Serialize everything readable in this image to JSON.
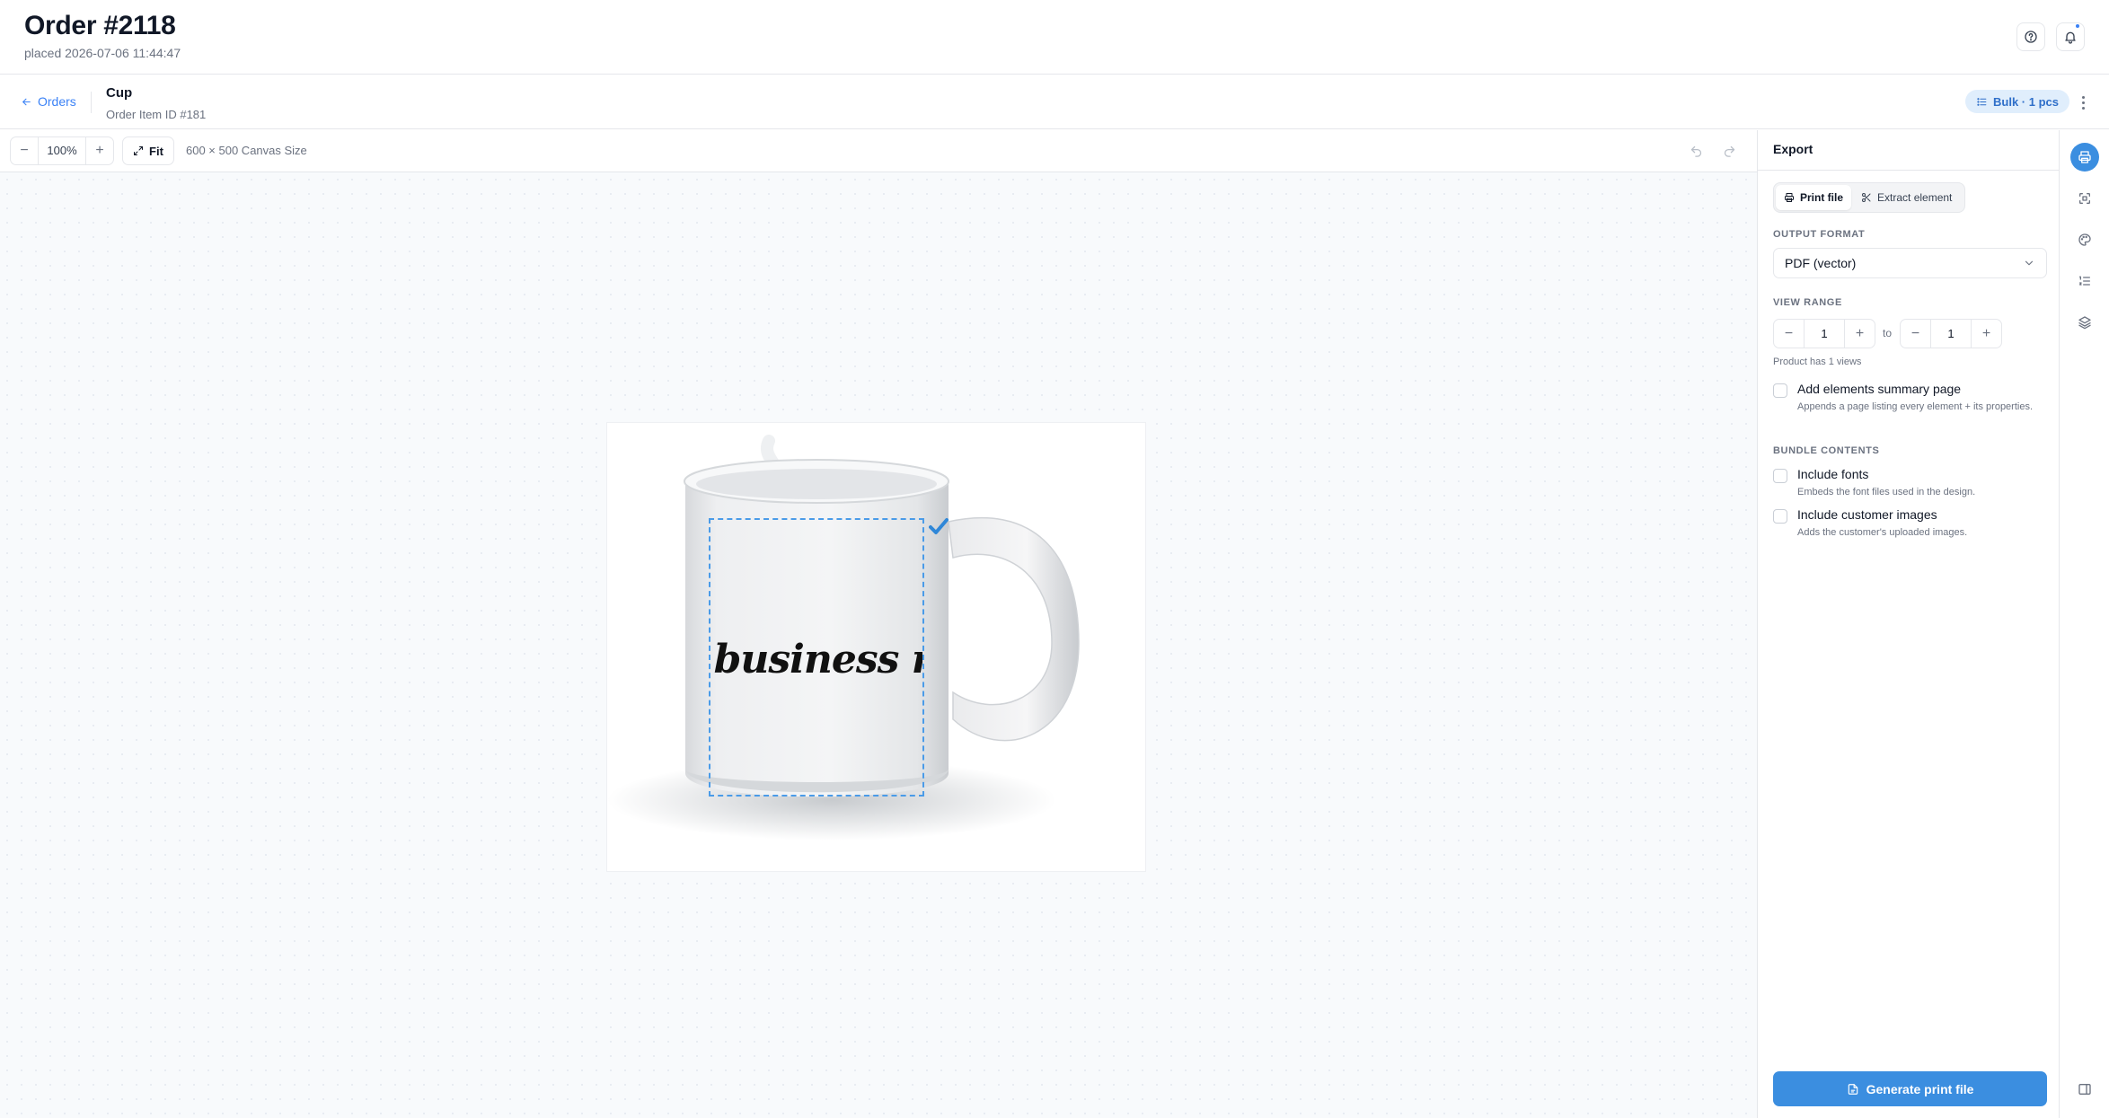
{
  "header": {
    "title": "Order #2118",
    "subtitle": "placed 2026-07-06 11:44:47",
    "help_icon": "help-circle-icon",
    "bell_icon": "bell-icon",
    "notification_dot_color": "#3b82f6"
  },
  "subheader": {
    "back_label": "Orders",
    "product_name": "Cup",
    "item_id": "Order Item ID #181",
    "bulk_badge": "Bulk · 1 pcs",
    "more_icon": "more-vertical-icon"
  },
  "toolbar": {
    "zoom_minus": "−",
    "zoom_value": "100%",
    "zoom_plus": "+",
    "fit_label": "Fit",
    "canvas_size": "600 × 500 Canvas Size",
    "undo_icon": "undo-icon",
    "redo_icon": "redo-icon"
  },
  "canvas": {
    "design_text": "Your business name",
    "print_area_color": "#4a9be8",
    "product_image": "white-ceramic-mug"
  },
  "export_panel": {
    "title": "Export",
    "tabs": [
      {
        "label": "Print file",
        "icon": "printer-icon",
        "active": true
      },
      {
        "label": "Extract element",
        "icon": "scissors-icon",
        "active": false
      }
    ],
    "output_format_label": "OUTPUT FORMAT",
    "output_format_value": "PDF (vector)",
    "view_range_label": "VIEW RANGE",
    "range_from": "1",
    "range_to_label": "to",
    "range_to": "1",
    "views_hint": "Product has 1 views",
    "summary_page": {
      "title": "Add elements summary page",
      "description": "Appends a page listing every element + its properties.",
      "checked": false
    },
    "bundle_label": "BUNDLE CONTENTS",
    "include_fonts": {
      "title": "Include fonts",
      "description": "Embeds the font files used in the design.",
      "checked": false
    },
    "include_images": {
      "title": "Include customer images",
      "description": "Adds the customer's uploaded images.",
      "checked": false
    },
    "generate_label": "Generate print file",
    "accent_color": "#3b8ee0"
  },
  "rail": {
    "items": [
      {
        "icon": "printer-icon",
        "active": true
      },
      {
        "icon": "scan-icon",
        "active": false
      },
      {
        "icon": "palette-icon",
        "active": false
      },
      {
        "icon": "list-ordered-icon",
        "active": false
      },
      {
        "icon": "layers-icon",
        "active": false
      }
    ],
    "bottom_icon": "sidebar-toggle-icon"
  }
}
